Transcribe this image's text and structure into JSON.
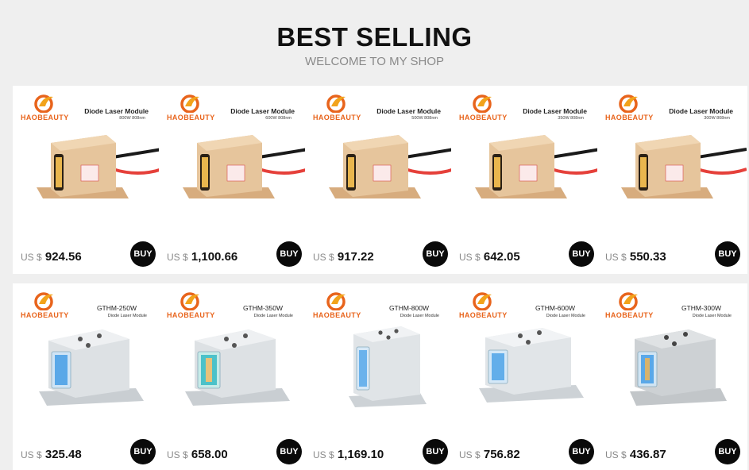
{
  "header": {
    "title": "BEST SELLING",
    "subtitle": "WELCOME TO MY SHOP"
  },
  "brand": {
    "name": "HAOBEAUTY",
    "logo_icon": "phoenix-logo-icon"
  },
  "currency_label": "US $",
  "buy_label": "BUY",
  "products_top": [
    {
      "title": "Diode Laser Module",
      "spec": "800W 808nm",
      "price": "924.56"
    },
    {
      "title": "Diode Laser Module",
      "spec": "600W 808nm",
      "price": "1,100.66"
    },
    {
      "title": "Diode Laser Module",
      "spec": "500W 808nm",
      "price": "917.22"
    },
    {
      "title": "Diode Laser Module",
      "spec": "350W 808nm",
      "price": "642.05"
    },
    {
      "title": "Diode Laser Module",
      "spec": "300W 808nm",
      "price": "550.33"
    }
  ],
  "products_bottom": [
    {
      "title": "GTHM-250W",
      "spec": "Diode Laser Module",
      "price": "325.48"
    },
    {
      "title": "GTHM-350W",
      "spec": "Diode Laser Module",
      "price": "658.00"
    },
    {
      "title": "GTHM-800W",
      "spec": "Diode Laser Module",
      "price": "1,169.10"
    },
    {
      "title": "GTHM-600W",
      "spec": "Diode Laser Module",
      "price": "756.82"
    },
    {
      "title": "GTHM-300W",
      "spec": "Diode Laser Module",
      "price": "436.87"
    }
  ],
  "colors": {
    "brand_orange": "#e8641c",
    "buy_bg": "#0a0a0a",
    "gold_module": "#e2bf93",
    "silver_module": "#d9dde0",
    "laser_blue": "#5aa8e8"
  }
}
